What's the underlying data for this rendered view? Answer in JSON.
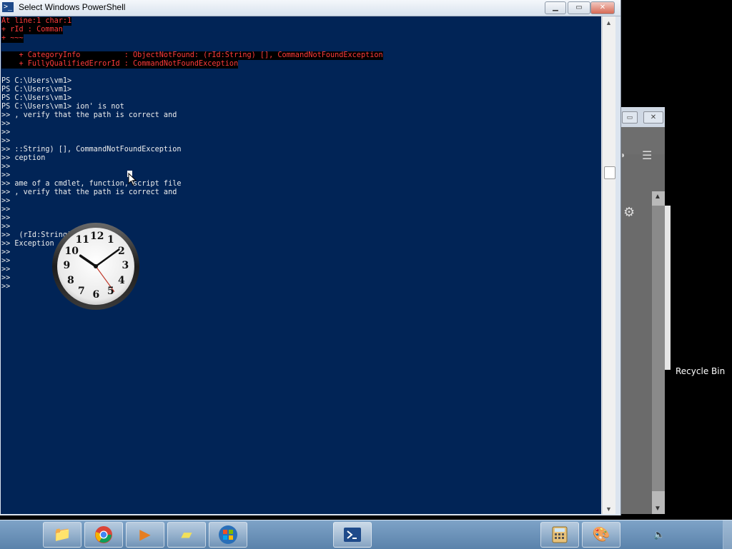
{
  "window": {
    "title": "Select Windows PowerShell",
    "minimize": "▁",
    "maximize": "▭",
    "close": "✕"
  },
  "console": {
    "lines": [
      {
        "text": "At line:1 char:1",
        "error": true
      },
      {
        "text": "+ rId : Comman",
        "error": true
      },
      {
        "text": "+ ~~~",
        "error": true
      },
      {
        "text": "",
        "error": false
      },
      {
        "text": "    + CategoryInfo          : ObjectNotFound: (rId:String) [], CommandNotFoundException",
        "error": true
      },
      {
        "text": "    + FullyQualifiedErrorId : CommandNotFoundException",
        "error": true
      },
      {
        "text": "",
        "error": false
      },
      {
        "text": "PS C:\\Users\\vm1>",
        "error": false
      },
      {
        "text": "PS C:\\Users\\vm1>",
        "error": false
      },
      {
        "text": "PS C:\\Users\\vm1>",
        "error": false
      },
      {
        "text": "PS C:\\Users\\vm1> ion' is not",
        "error": false
      },
      {
        "text": ">> , verify that the path is correct and",
        "error": false
      },
      {
        "text": ">>",
        "error": false
      },
      {
        "text": ">>",
        "error": false
      },
      {
        "text": ">>",
        "error": false
      },
      {
        "text": ">> ::String) [], CommandNotFoundException",
        "error": false
      },
      {
        "text": ">> ception",
        "error": false
      },
      {
        "text": ">>",
        "error": false
      },
      {
        "text": ">>",
        "error": false
      },
      {
        "text": ">> ame of a cmdlet, function, script file",
        "error": false
      },
      {
        "text": ">> , verify that the path is correct and",
        "error": false
      },
      {
        "text": ">>",
        "error": false
      },
      {
        "text": ">>",
        "error": false
      },
      {
        "text": ">>",
        "error": false
      },
      {
        "text": ">>",
        "error": false
      },
      {
        "text": ">>  (rId:String)",
        "error": false
      },
      {
        "text": ">> Exception",
        "error": false
      },
      {
        "text": ">>",
        "error": false
      },
      {
        "text": ">>",
        "error": false
      },
      {
        "text": ">>",
        "error": false
      },
      {
        "text": ">>",
        "error": false
      },
      {
        "text": ">>",
        "error": false
      }
    ]
  },
  "clock": {
    "numbers": [
      "12",
      "1",
      "2",
      "3",
      "4",
      "5",
      "6",
      "7",
      "8",
      "9",
      "10",
      "11"
    ],
    "time_shown": {
      "hour": 10,
      "minute": 9,
      "second": 24
    }
  },
  "desktop": {
    "recycle_bin_label": "Recycle Bin"
  },
  "taskbar": {
    "items": [
      "file-explorer-icon",
      "chrome-icon",
      "media-player-icon",
      "sticky-notes-icon",
      "start-orb-icon",
      "powershell-icon",
      "calculator-icon",
      "paint-icon"
    ]
  },
  "colors": {
    "console_bg": "#012456",
    "error_fg": "#ff3b3b",
    "taskbar": "#6d93ba"
  }
}
